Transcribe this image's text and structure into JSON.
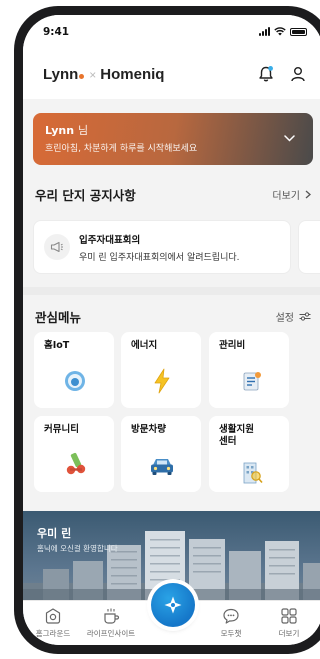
{
  "status_bar": {
    "time": "9:41"
  },
  "header": {
    "brand_lynn": "Lynn",
    "brand_separator": "×",
    "brand_homeniq": "Homeniq",
    "icons": [
      "notification-bell-icon",
      "profile-icon"
    ],
    "accent": "#e8742c"
  },
  "greeting": {
    "name": "Lynn",
    "honorific": "님",
    "message": "흐린아침, 차분하게 하루를 시작해보세요"
  },
  "notice": {
    "title": "우리 단지 공지사항",
    "more_label": "더보기",
    "item_title": "입주자대표회의",
    "item_body": "우미 린 입주자대표회의에서 알려드립니다."
  },
  "menu": {
    "title": "관심메뉴",
    "settings_label": "설정",
    "items": [
      {
        "label": "홈IoT",
        "icon": "smart-speaker-icon"
      },
      {
        "label": "에너지",
        "icon": "lightning-icon"
      },
      {
        "label": "관리비",
        "icon": "bill-icon"
      },
      {
        "label": "커뮤니티",
        "icon": "dumbbell-icon"
      },
      {
        "label": "방문차량",
        "icon": "car-icon"
      },
      {
        "label": "생활지원\n센터",
        "icon": "building-search-icon"
      }
    ]
  },
  "banner": {
    "title": "우미 린",
    "subtitle": "홈닉에 오신걸 환영합니다"
  },
  "bottom_nav": {
    "items": [
      {
        "label": "홈그라운드",
        "icon": "home-ground-icon"
      },
      {
        "label": "라이프인사이트",
        "icon": "coffee-cup-icon"
      },
      {
        "label": "모두챗",
        "icon": "chat-bubble-icon"
      },
      {
        "label": "더보기",
        "icon": "grid-icon"
      }
    ],
    "fab_icon": "compass-star-icon"
  }
}
